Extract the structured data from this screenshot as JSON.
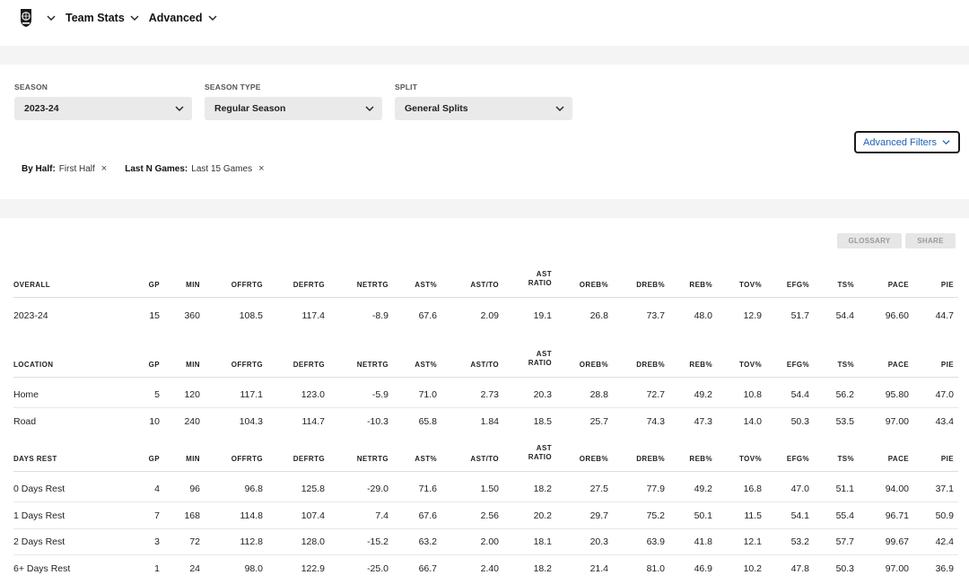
{
  "nav": {
    "team_stats_label": "Team Stats",
    "advanced_label": "Advanced"
  },
  "filters": {
    "season": {
      "label": "SEASON",
      "value": "2023-24"
    },
    "season_type": {
      "label": "SEASON TYPE",
      "value": "Regular Season"
    },
    "split": {
      "label": "SPLIT",
      "value": "General Splits"
    },
    "advanced_filters_label": "Advanced Filters"
  },
  "chips": [
    {
      "key": "By Half:",
      "value": "First Half",
      "close": "×"
    },
    {
      "key": "Last N Games:",
      "value": "Last 15 Games",
      "close": "×"
    }
  ],
  "buttons": {
    "glossary": "GLOSSARY",
    "share": "SHARE"
  },
  "columns": [
    "GP",
    "MIN",
    "OFFRTG",
    "DEFRTG",
    "NETRTG",
    "AST%",
    "AST/TO",
    [
      "AST",
      "RATIO"
    ],
    "OREB%",
    "DREB%",
    "REB%",
    "TOV%",
    "EFG%",
    "TS%",
    "PACE",
    "PIE"
  ],
  "sections": [
    {
      "title": "OVERALL",
      "rows": [
        [
          "2023-24",
          "15",
          "360",
          "108.5",
          "117.4",
          "-8.9",
          "67.6",
          "2.09",
          "19.1",
          "26.8",
          "73.7",
          "48.0",
          "12.9",
          "51.7",
          "54.4",
          "96.60",
          "44.7"
        ]
      ]
    },
    {
      "title": "LOCATION",
      "rows": [
        [
          "Home",
          "5",
          "120",
          "117.1",
          "123.0",
          "-5.9",
          "71.0",
          "2.73",
          "20.3",
          "28.8",
          "72.7",
          "49.2",
          "10.8",
          "54.4",
          "56.2",
          "95.80",
          "47.0"
        ],
        [
          "Road",
          "10",
          "240",
          "104.3",
          "114.7",
          "-10.3",
          "65.8",
          "1.84",
          "18.5",
          "25.7",
          "74.3",
          "47.3",
          "14.0",
          "50.3",
          "53.5",
          "97.00",
          "43.4"
        ]
      ]
    },
    {
      "title": "DAYS REST",
      "rows": [
        [
          "0 Days Rest",
          "4",
          "96",
          "96.8",
          "125.8",
          "-29.0",
          "71.6",
          "1.50",
          "18.2",
          "27.5",
          "77.9",
          "49.2",
          "16.8",
          "47.0",
          "51.1",
          "94.00",
          "37.1"
        ],
        [
          "1 Days Rest",
          "7",
          "168",
          "114.8",
          "107.4",
          "7.4",
          "67.6",
          "2.56",
          "20.2",
          "29.7",
          "75.2",
          "50.1",
          "11.5",
          "54.1",
          "55.4",
          "96.71",
          "50.9"
        ],
        [
          "2 Days Rest",
          "3",
          "72",
          "112.8",
          "128.0",
          "-15.2",
          "63.2",
          "2.00",
          "18.1",
          "20.3",
          "63.9",
          "41.8",
          "12.1",
          "53.2",
          "57.7",
          "99.67",
          "42.4"
        ],
        [
          "6+ Days Rest",
          "1",
          "24",
          "98.0",
          "122.9",
          "-25.0",
          "66.7",
          "2.40",
          "18.2",
          "21.4",
          "81.0",
          "46.9",
          "10.2",
          "47.8",
          "50.3",
          "97.00",
          "36.9"
        ]
      ]
    }
  ]
}
